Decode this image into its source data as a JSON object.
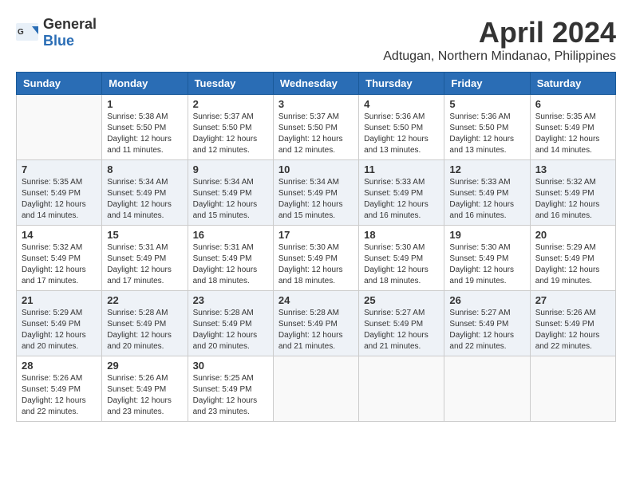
{
  "header": {
    "logo_general": "General",
    "logo_blue": "Blue",
    "month_title": "April 2024",
    "location": "Adtugan, Northern Mindanao, Philippines"
  },
  "weekdays": [
    "Sunday",
    "Monday",
    "Tuesday",
    "Wednesday",
    "Thursday",
    "Friday",
    "Saturday"
  ],
  "weeks": [
    [
      {
        "day": "",
        "info": ""
      },
      {
        "day": "1",
        "info": "Sunrise: 5:38 AM\nSunset: 5:50 PM\nDaylight: 12 hours\nand 11 minutes."
      },
      {
        "day": "2",
        "info": "Sunrise: 5:37 AM\nSunset: 5:50 PM\nDaylight: 12 hours\nand 12 minutes."
      },
      {
        "day": "3",
        "info": "Sunrise: 5:37 AM\nSunset: 5:50 PM\nDaylight: 12 hours\nand 12 minutes."
      },
      {
        "day": "4",
        "info": "Sunrise: 5:36 AM\nSunset: 5:50 PM\nDaylight: 12 hours\nand 13 minutes."
      },
      {
        "day": "5",
        "info": "Sunrise: 5:36 AM\nSunset: 5:50 PM\nDaylight: 12 hours\nand 13 minutes."
      },
      {
        "day": "6",
        "info": "Sunrise: 5:35 AM\nSunset: 5:49 PM\nDaylight: 12 hours\nand 14 minutes."
      }
    ],
    [
      {
        "day": "7",
        "info": "Sunrise: 5:35 AM\nSunset: 5:49 PM\nDaylight: 12 hours\nand 14 minutes."
      },
      {
        "day": "8",
        "info": "Sunrise: 5:34 AM\nSunset: 5:49 PM\nDaylight: 12 hours\nand 14 minutes."
      },
      {
        "day": "9",
        "info": "Sunrise: 5:34 AM\nSunset: 5:49 PM\nDaylight: 12 hours\nand 15 minutes."
      },
      {
        "day": "10",
        "info": "Sunrise: 5:34 AM\nSunset: 5:49 PM\nDaylight: 12 hours\nand 15 minutes."
      },
      {
        "day": "11",
        "info": "Sunrise: 5:33 AM\nSunset: 5:49 PM\nDaylight: 12 hours\nand 16 minutes."
      },
      {
        "day": "12",
        "info": "Sunrise: 5:33 AM\nSunset: 5:49 PM\nDaylight: 12 hours\nand 16 minutes."
      },
      {
        "day": "13",
        "info": "Sunrise: 5:32 AM\nSunset: 5:49 PM\nDaylight: 12 hours\nand 16 minutes."
      }
    ],
    [
      {
        "day": "14",
        "info": "Sunrise: 5:32 AM\nSunset: 5:49 PM\nDaylight: 12 hours\nand 17 minutes."
      },
      {
        "day": "15",
        "info": "Sunrise: 5:31 AM\nSunset: 5:49 PM\nDaylight: 12 hours\nand 17 minutes."
      },
      {
        "day": "16",
        "info": "Sunrise: 5:31 AM\nSunset: 5:49 PM\nDaylight: 12 hours\nand 18 minutes."
      },
      {
        "day": "17",
        "info": "Sunrise: 5:30 AM\nSunset: 5:49 PM\nDaylight: 12 hours\nand 18 minutes."
      },
      {
        "day": "18",
        "info": "Sunrise: 5:30 AM\nSunset: 5:49 PM\nDaylight: 12 hours\nand 18 minutes."
      },
      {
        "day": "19",
        "info": "Sunrise: 5:30 AM\nSunset: 5:49 PM\nDaylight: 12 hours\nand 19 minutes."
      },
      {
        "day": "20",
        "info": "Sunrise: 5:29 AM\nSunset: 5:49 PM\nDaylight: 12 hours\nand 19 minutes."
      }
    ],
    [
      {
        "day": "21",
        "info": "Sunrise: 5:29 AM\nSunset: 5:49 PM\nDaylight: 12 hours\nand 20 minutes."
      },
      {
        "day": "22",
        "info": "Sunrise: 5:28 AM\nSunset: 5:49 PM\nDaylight: 12 hours\nand 20 minutes."
      },
      {
        "day": "23",
        "info": "Sunrise: 5:28 AM\nSunset: 5:49 PM\nDaylight: 12 hours\nand 20 minutes."
      },
      {
        "day": "24",
        "info": "Sunrise: 5:28 AM\nSunset: 5:49 PM\nDaylight: 12 hours\nand 21 minutes."
      },
      {
        "day": "25",
        "info": "Sunrise: 5:27 AM\nSunset: 5:49 PM\nDaylight: 12 hours\nand 21 minutes."
      },
      {
        "day": "26",
        "info": "Sunrise: 5:27 AM\nSunset: 5:49 PM\nDaylight: 12 hours\nand 22 minutes."
      },
      {
        "day": "27",
        "info": "Sunrise: 5:26 AM\nSunset: 5:49 PM\nDaylight: 12 hours\nand 22 minutes."
      }
    ],
    [
      {
        "day": "28",
        "info": "Sunrise: 5:26 AM\nSunset: 5:49 PM\nDaylight: 12 hours\nand 22 minutes."
      },
      {
        "day": "29",
        "info": "Sunrise: 5:26 AM\nSunset: 5:49 PM\nDaylight: 12 hours\nand 23 minutes."
      },
      {
        "day": "30",
        "info": "Sunrise: 5:25 AM\nSunset: 5:49 PM\nDaylight: 12 hours\nand 23 minutes."
      },
      {
        "day": "",
        "info": ""
      },
      {
        "day": "",
        "info": ""
      },
      {
        "day": "",
        "info": ""
      },
      {
        "day": "",
        "info": ""
      }
    ]
  ]
}
